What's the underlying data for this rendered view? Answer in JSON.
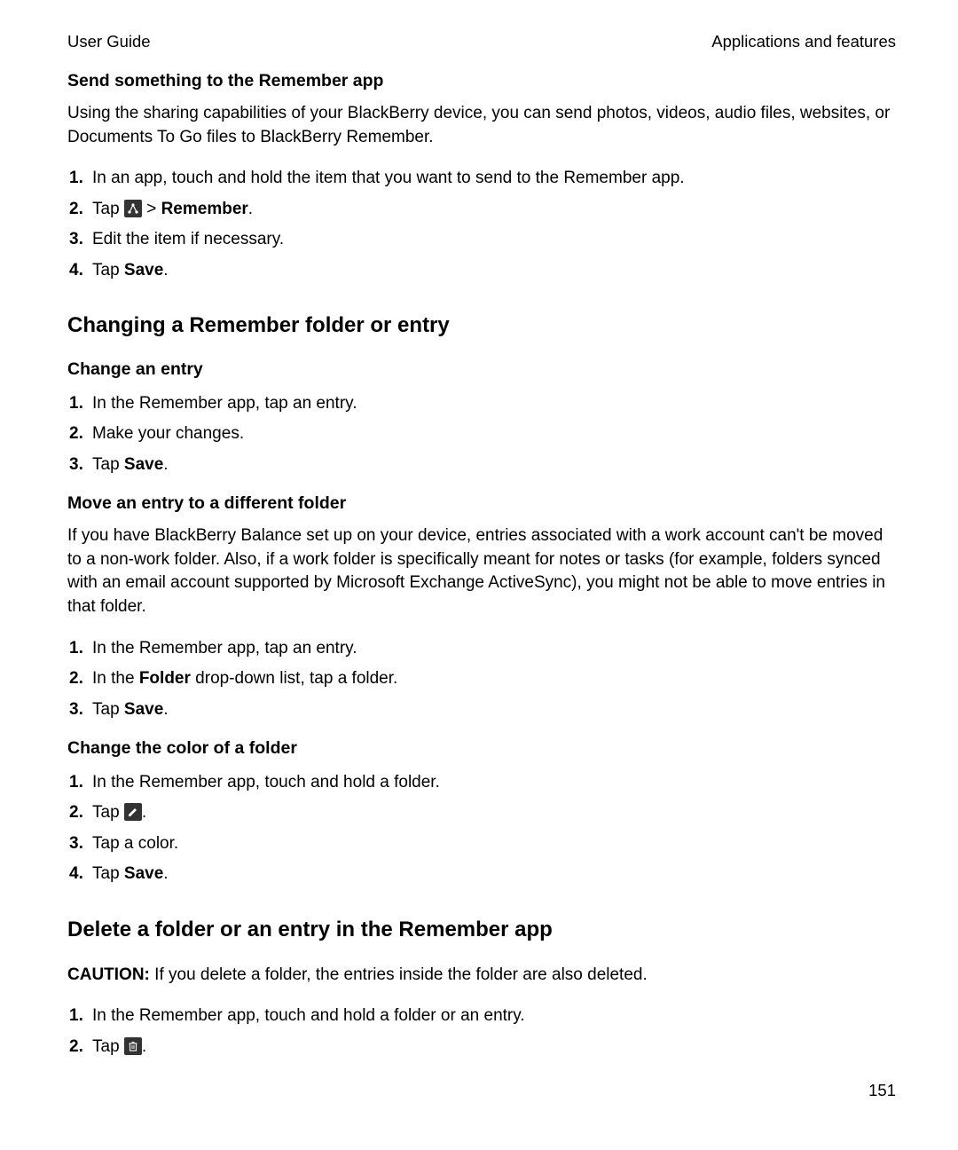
{
  "header": {
    "left": "User Guide",
    "right": "Applications and features"
  },
  "section1": {
    "title": "Send something to the Remember app",
    "para": "Using the sharing capabilities of your BlackBerry device, you can send photos, videos, audio files, websites, or Documents To Go files to BlackBerry Remember.",
    "steps": [
      {
        "n": "1.",
        "text": "In an app, touch and hold the item that you want to send to the Remember app."
      },
      {
        "n": "2.",
        "pre": "Tap ",
        "icon": "share-icon",
        "mid": " > ",
        "bold": "Remember",
        "post": "."
      },
      {
        "n": "3.",
        "text": "Edit the item if necessary."
      },
      {
        "n": "4.",
        "pre": "Tap ",
        "bold": "Save",
        "post": "."
      }
    ]
  },
  "section2": {
    "title": "Changing a Remember folder or entry",
    "sub1": {
      "title": "Change an entry",
      "steps": [
        {
          "n": "1.",
          "text": "In the Remember app, tap an entry."
        },
        {
          "n": "2.",
          "text": "Make your changes."
        },
        {
          "n": "3.",
          "pre": "Tap ",
          "bold": "Save",
          "post": "."
        }
      ]
    },
    "sub2": {
      "title": "Move an entry to a different folder",
      "para": "If you have BlackBerry Balance set up on your device, entries associated with a work account can't be moved to a non-work folder. Also, if a work folder is specifically meant for notes or tasks (for example, folders synced with an email account supported by Microsoft Exchange ActiveSync), you might not be able to move entries in that folder.",
      "steps": [
        {
          "n": "1.",
          "text": "In the Remember app, tap an entry."
        },
        {
          "n": "2.",
          "pre": "In the ",
          "bold": "Folder",
          "post": " drop-down list, tap a folder."
        },
        {
          "n": "3.",
          "pre": "Tap ",
          "bold": "Save",
          "post": "."
        }
      ]
    },
    "sub3": {
      "title": "Change the color of a folder",
      "steps": [
        {
          "n": "1.",
          "text": "In the Remember app, touch and hold a folder."
        },
        {
          "n": "2.",
          "pre": "Tap ",
          "icon": "edit-icon",
          "post": "."
        },
        {
          "n": "3.",
          "text": "Tap a color."
        },
        {
          "n": "4.",
          "pre": "Tap ",
          "bold": "Save",
          "post": "."
        }
      ]
    }
  },
  "section3": {
    "title": "Delete a folder or an entry in the Remember app",
    "para_bold": "CAUTION:",
    "para_rest": " If you delete a folder, the entries inside the folder are also deleted.",
    "steps": [
      {
        "n": "1.",
        "text": "In the Remember app, touch and hold a folder or an entry."
      },
      {
        "n": "2.",
        "pre": "Tap ",
        "icon": "trash-icon",
        "post": "."
      }
    ]
  },
  "page_number": "151"
}
